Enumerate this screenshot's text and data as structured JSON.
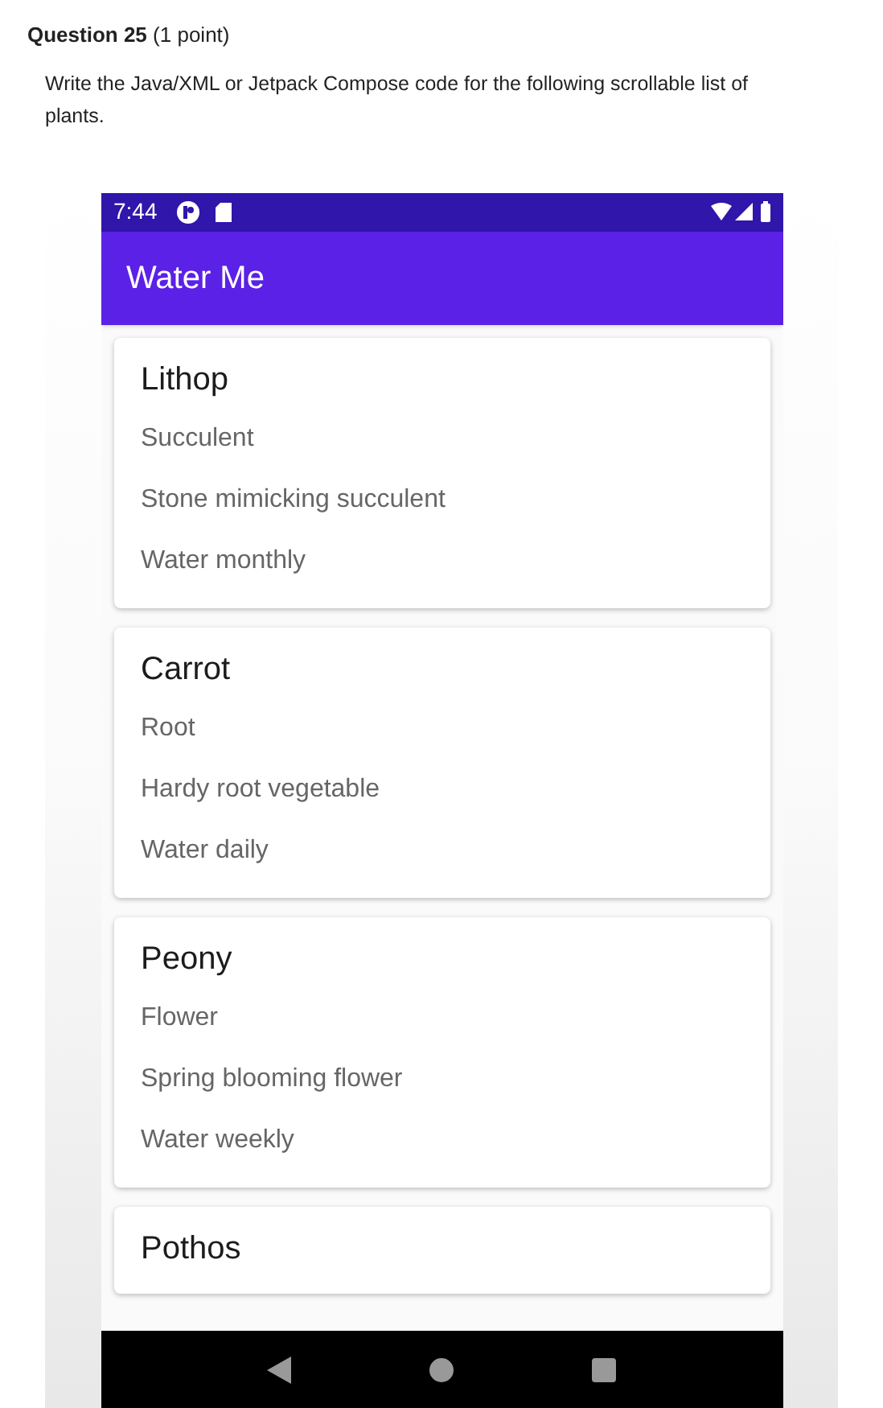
{
  "question": {
    "number": "Question 25",
    "points": "(1 point)",
    "prompt": "Write the Java/XML or Jetpack Compose code for the following scrollable list of plants."
  },
  "phone": {
    "status_bar": {
      "time": "7:44"
    },
    "app_bar": {
      "title": "Water Me"
    },
    "plants": [
      {
        "name": "Lithop",
        "type": "Succulent",
        "description": "Stone mimicking succulent",
        "schedule": "Water monthly"
      },
      {
        "name": "Carrot",
        "type": "Root",
        "description": "Hardy root vegetable",
        "schedule": "Water daily"
      },
      {
        "name": "Peony",
        "type": "Flower",
        "description": "Spring blooming flower",
        "schedule": "Water weekly"
      },
      {
        "name": "Pothos"
      }
    ]
  }
}
